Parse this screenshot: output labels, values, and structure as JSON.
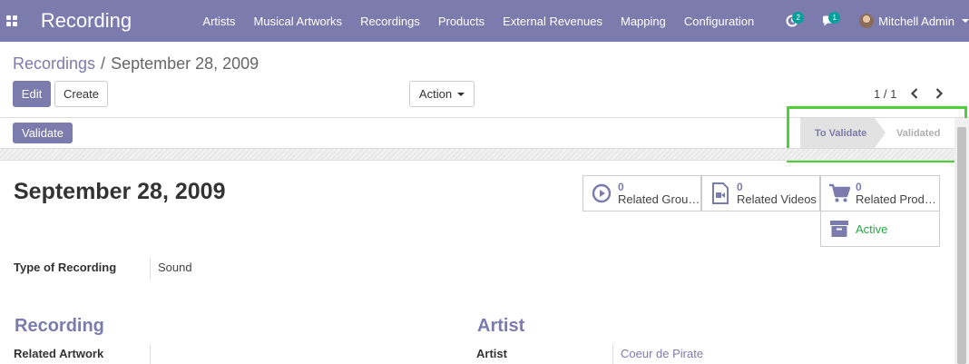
{
  "app": {
    "title": "Recording",
    "menu": [
      "Artists",
      "Musical Artworks",
      "Recordings",
      "Products",
      "External Revenues",
      "Mapping",
      "Configuration"
    ],
    "activity_count": "2",
    "messages_count": "1",
    "user_name": "Mitchell Admin"
  },
  "breadcrumb": {
    "parent": "Recordings",
    "separator": "/",
    "current": "September 28, 2009"
  },
  "toolbar": {
    "edit_label": "Edit",
    "create_label": "Create",
    "action_label": "Action",
    "pager": "1 / 1"
  },
  "statusbar": {
    "validate_label": "Validate",
    "steps": [
      "To Validate",
      "Validated"
    ],
    "current_step": "To Validate"
  },
  "record": {
    "title": "September 28, 2009"
  },
  "smart_buttons": {
    "groups": {
      "value": "0",
      "label": "Related Grou…"
    },
    "videos": {
      "value": "0",
      "label": "Related Videos"
    },
    "products": {
      "value": "0",
      "label": "Related Prod…"
    },
    "active": {
      "label": "Active"
    }
  },
  "fields": {
    "type_of_recording": {
      "label": "Type of Recording",
      "value": "Sound"
    }
  },
  "sections": {
    "recording": {
      "title": "Recording",
      "related_artwork_label": "Related Artwork",
      "related_artwork_value": ""
    },
    "artist": {
      "title": "Artist",
      "artist_label": "Artist",
      "artist_value": "Coeur de Pirate"
    }
  },
  "colors": {
    "brand": "#7c7bad",
    "badge": "#00a09d",
    "active": "#28a745",
    "highlight": "#4cd137"
  }
}
